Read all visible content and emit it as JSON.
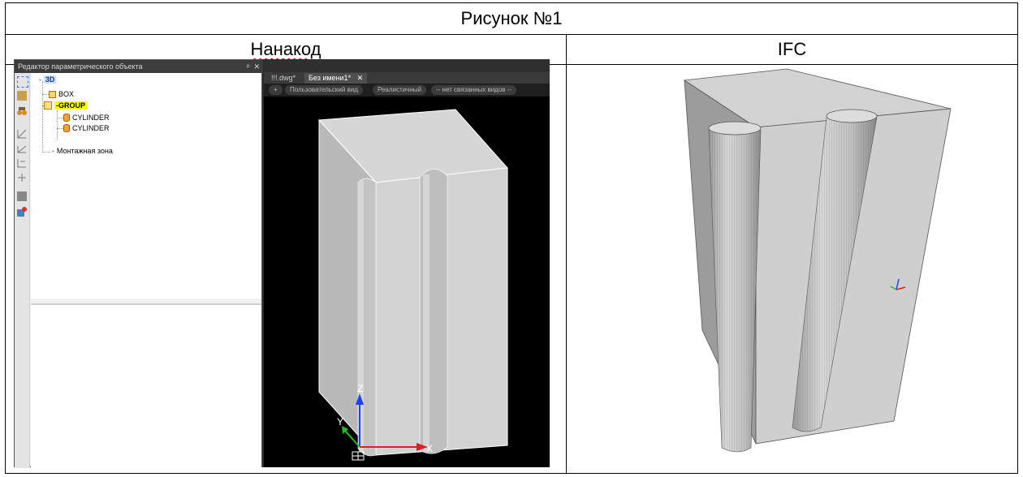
{
  "figure": {
    "title": "Рисунок №1"
  },
  "columns": {
    "left": "Нанакод",
    "right": "IFC"
  },
  "panel": {
    "title": "Редактор параметрического объекта",
    "pin_glyph": "ᵖ",
    "close_glyph": "✕",
    "tree": {
      "root": "3D",
      "box": "BOX",
      "group": "-GROUP",
      "cylinder1": "CYLINDER",
      "cylinder2": "CYLINDER",
      "zone": "Монтажная зона"
    }
  },
  "viewport": {
    "tabs": [
      "!!!.dwg*",
      "Без имени1*"
    ],
    "tab_close": "✕",
    "chips": [
      "+",
      "Пользовательский вид",
      "Реалистичный",
      "-- нет связанных видов --"
    ],
    "axis_z": "Z",
    "axis_y": "Y",
    "axis_x": "X"
  },
  "colors": {
    "viewport_bg": "#000000",
    "group_highlight": "#ffff00",
    "axis_x": "#e02020",
    "axis_y": "#20c020",
    "axis_z": "#2040ff"
  }
}
